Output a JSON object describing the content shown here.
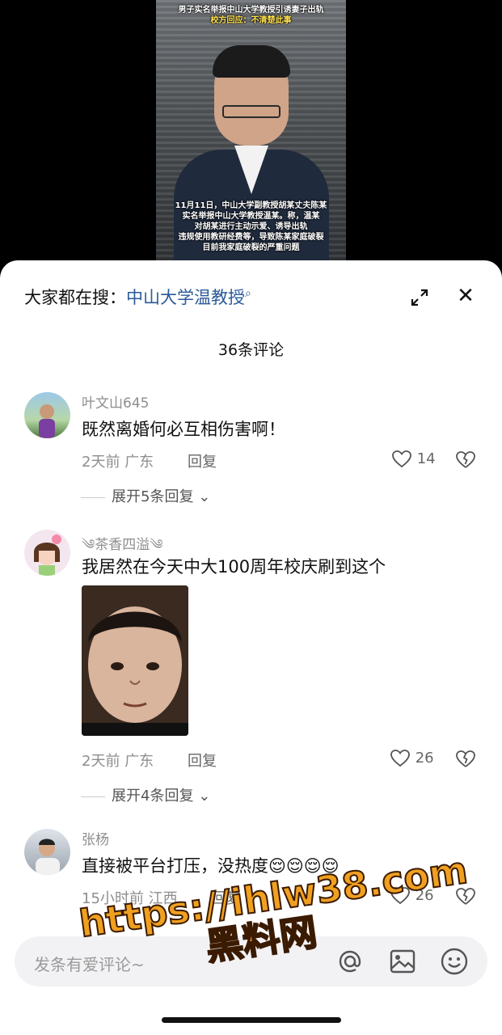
{
  "video": {
    "caption_top_line1": "男子实名举报中山大学教授引诱妻子出轨",
    "caption_top_line2": "校方回应：不清楚此事",
    "caption_bottom": [
      "11月11日，中山大学副教授胡某丈夫陈某",
      "实名举报中山大学教授温某。称，温某",
      "对胡某进行主动示爱、诱导出轨",
      "违规使用教研经费等，导致陈某家庭破裂",
      "目前我家庭破裂的严重问题"
    ]
  },
  "search": {
    "prefix": "大家都在搜：",
    "query": "中山大学温教授",
    "icon": "search-icon"
  },
  "comment_count": "36条评论",
  "comments": [
    {
      "user": "叶文山645",
      "text": "既然离婚何必互相伤害啊！",
      "time": "2天前",
      "location": "广东",
      "reply": "回复",
      "likes": "14",
      "expand": "展开5条回复"
    },
    {
      "user": "༄茶香四溢༄",
      "text": "我居然在今天中大100周年校庆刷到这个",
      "time": "2天前",
      "location": "广东",
      "reply": "回复",
      "likes": "26",
      "expand": "展开4条回复"
    },
    {
      "user": "张杨",
      "text": "直接被平台打压，没热度😌😌😌😌",
      "time": "15小时前",
      "location": "江西",
      "reply": "回复",
      "likes": "26"
    }
  ],
  "input": {
    "placeholder": "发条有爱评论~"
  },
  "watermark": {
    "line1": "https://ihlw38.com",
    "line2": "黑料网"
  }
}
